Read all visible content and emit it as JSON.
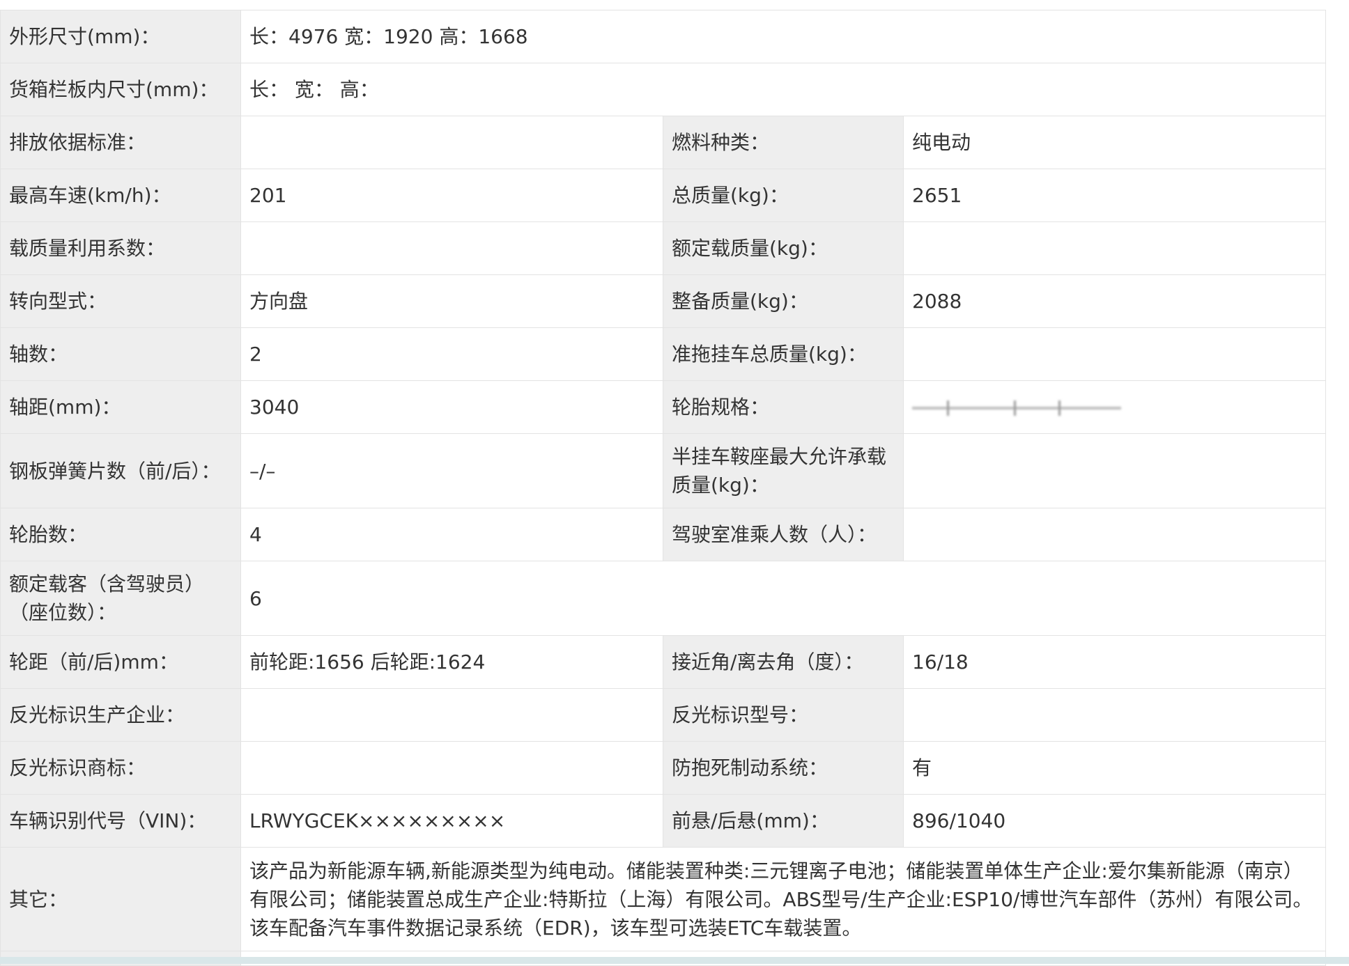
{
  "specs": {
    "dimensions": {
      "label": "外形尺寸(mm)：",
      "value": "长：4976 宽：1920 高：1668"
    },
    "cargo_box": {
      "label": "货箱栏板内尺寸(mm)：",
      "value": "长：  宽：  高："
    },
    "emission_standard": {
      "label": "排放依据标准：",
      "value": ""
    },
    "fuel_type": {
      "label": "燃料种类：",
      "value": "纯电动"
    },
    "max_speed": {
      "label": "最高车速(km/h)：",
      "value": "201"
    },
    "gross_mass": {
      "label": "总质量(kg)：",
      "value": "2651"
    },
    "load_mass_coef": {
      "label": "载质量利用系数：",
      "value": ""
    },
    "rated_load": {
      "label": "额定载质量(kg)：",
      "value": ""
    },
    "steering": {
      "label": "转向型式：",
      "value": "方向盘"
    },
    "curb_mass": {
      "label": "整备质量(kg)：",
      "value": "2088"
    },
    "axles": {
      "label": "轴数：",
      "value": "2"
    },
    "trailer_mass": {
      "label": "准拖挂车总质量(kg)：",
      "value": ""
    },
    "wheelbase": {
      "label": "轴距(mm)：",
      "value": "3040"
    },
    "tire_spec": {
      "label": "轮胎规格：",
      "value": ""
    },
    "leaf_springs": {
      "label": "钢板弹簧片数（前/后）：",
      "value": "–/–"
    },
    "saddle_load": {
      "label": "半挂车鞍座最大允许承载质量(kg)：",
      "value": ""
    },
    "tire_count": {
      "label": "轮胎数：",
      "value": "4"
    },
    "cab_passengers": {
      "label": "驾驶室准乘人数（人）：",
      "value": ""
    },
    "rated_passengers": {
      "label": "额定载客（含驾驶员）（座位数）：",
      "value": "6"
    },
    "track": {
      "label": "轮距（前/后)mm：",
      "value": "前轮距:1656 后轮距:1624"
    },
    "approach_departure": {
      "label": "接近角/离去角（度）：",
      "value": "16/18"
    },
    "reflector_maker": {
      "label": "反光标识生产企业：",
      "value": ""
    },
    "reflector_model": {
      "label": "反光标识型号：",
      "value": ""
    },
    "reflector_brand": {
      "label": "反光标识商标：",
      "value": ""
    },
    "abs": {
      "label": "防抱死制动系统：",
      "value": "有"
    },
    "vin": {
      "label": "车辆识别代号（VIN)：",
      "value": "LRWYGCEK×××××××××"
    },
    "overhang": {
      "label": "前悬/后悬(mm)：",
      "value": "896/1040"
    },
    "other": {
      "label": "其它：",
      "value": "该产品为新能源车辆,新能源类型为纯电动。储能装置种类:三元锂离子电池；储能装置单体生产企业:爱尔集新能源（南京）有限公司；储能装置总成生产企业:特斯拉（上海）有限公司。ABS型号/生产企业:ESP10/博世汽车部件（苏州）有限公司。该车配备汽车事件数据记录系统（EDR)，该车型可选装ETC车载装置。"
    }
  }
}
